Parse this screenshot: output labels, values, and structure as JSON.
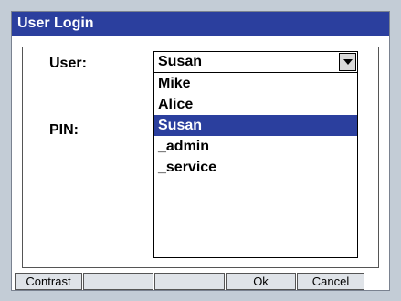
{
  "window": {
    "title": "User Login"
  },
  "form": {
    "user_label": "User:",
    "pin_label": "PIN:",
    "user_value": "Susan"
  },
  "dropdown": {
    "options": [
      "Mike",
      "Alice",
      "Susan",
      "_admin",
      "_service"
    ],
    "selected": "Susan"
  },
  "buttons": {
    "contrast": "Contrast",
    "blank1": "",
    "blank2": "",
    "ok": "Ok",
    "cancel": "Cancel"
  },
  "colors": {
    "accent": "#2b3f9e",
    "background": "#c3ccd6"
  }
}
